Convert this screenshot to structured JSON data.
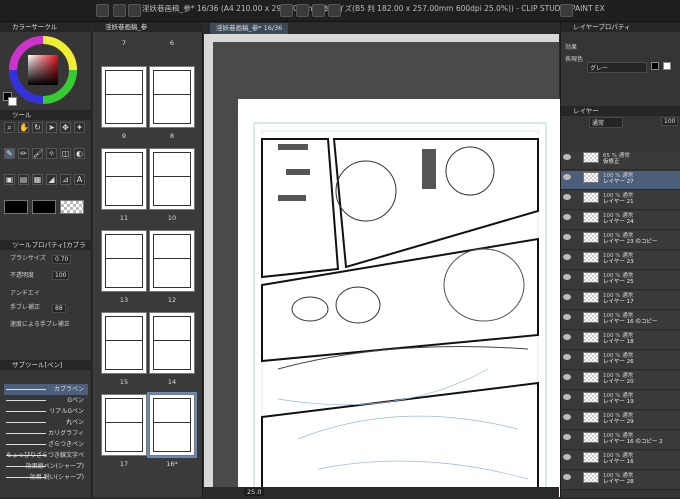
{
  "window": {
    "title": "淫妖巷画稿_参* 16/36 (A4 210.00 x 297.00mm 製本サイズ(B5 判 182.00 x 257.00mm 600dpi 25.0%)) - CLIP STUDIO PAINT EX"
  },
  "left": {
    "color_header": "カラーサークル",
    "tool_header": "ツール",
    "toolprop_header": "ツールプロパティ[カブラ",
    "props": [
      {
        "label": "ブラシサイズ",
        "value": "0.70"
      },
      {
        "label": "不透明度",
        "value": "100"
      },
      {
        "label": "アンチエイ",
        "value": ""
      },
      {
        "label": "手ブレ補正",
        "value": "88"
      },
      {
        "label": "速度による手ブレ補正",
        "value": ""
      }
    ],
    "subtool_header": "サブツール[ペン]",
    "subtools": [
      "カブラペン",
      "Gペン",
      "リアルGペン",
      "丸ペン",
      "カリグラフィ",
      "ざらつきペン",
      "ちょっぴりざらつき線文字ペ",
      "効果線ペン(シャープ)",
      "効果 鋭い(シャープ)"
    ]
  },
  "pages": {
    "tab": "淫妖巷画稿_参",
    "thumbs": [
      {
        "left": "9",
        "right": "8"
      },
      {
        "left": "11",
        "right": "10"
      },
      {
        "left": "13",
        "right": "12"
      },
      {
        "left": "15",
        "right": "14"
      },
      {
        "left": "17",
        "right": "16*"
      }
    ],
    "top_labels": [
      "7",
      "6"
    ]
  },
  "canvas": {
    "tab": "淫妖巷画稿_参* 16/36",
    "zoom": "25.0"
  },
  "right": {
    "layerprop_header": "レイヤープロパティ",
    "effect_label": "効果",
    "color_label": "表現色",
    "color_value": "グレー",
    "layer_header": "レイヤー",
    "blend": "通常",
    "opacity": "100",
    "layers": [
      {
        "l1": "65 % 通常",
        "l2": "仮修正"
      },
      {
        "l1": "100 % 通常",
        "l2": "レイヤー 27",
        "sel": true
      },
      {
        "l1": "100 % 通常",
        "l2": "レイヤー 21"
      },
      {
        "l1": "100 % 通常",
        "l2": "レイヤー 24"
      },
      {
        "l1": "100 % 通常",
        "l2": "レイヤー 23 のコピー"
      },
      {
        "l1": "100 % 通常",
        "l2": "レイヤー 23"
      },
      {
        "l1": "100 % 通常",
        "l2": "レイヤー 25"
      },
      {
        "l1": "100 % 通常",
        "l2": "レイヤー 17"
      },
      {
        "l1": "100 % 通常",
        "l2": "レイヤー 16 のコピー"
      },
      {
        "l1": "100 % 通常",
        "l2": "レイヤー 18"
      },
      {
        "l1": "100 % 通常",
        "l2": "レイヤー 26"
      },
      {
        "l1": "100 % 通常",
        "l2": "レイヤー 20"
      },
      {
        "l1": "100 % 通常",
        "l2": "レイヤー 19"
      },
      {
        "l1": "100 % 通常",
        "l2": "レイヤー 29"
      },
      {
        "l1": "100 % 通常",
        "l2": "レイヤー 16 のコピー 2"
      },
      {
        "l1": "100 % 通常",
        "l2": "レイヤー 16"
      },
      {
        "l1": "100 % 通常",
        "l2": "レイヤー 28"
      }
    ]
  }
}
